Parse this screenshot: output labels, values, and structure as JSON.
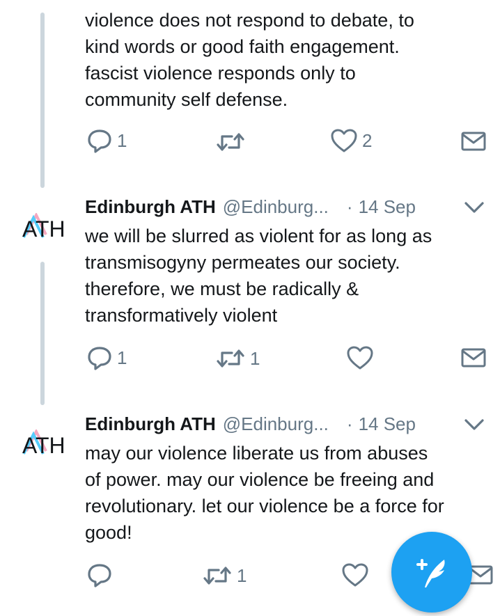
{
  "tweets": [
    {
      "text": "violence does not respond to debate, to\nkind words or good faith engagement.\nfascist violence responds only to\ncommunity self defense.",
      "reply_count": "1",
      "retweet_count": "",
      "like_count": "2"
    },
    {
      "avatar_text": "ATH",
      "name": "Edinburgh ATH",
      "handle": "@Edinburg...",
      "separator": "·",
      "time": "14 Sep",
      "text": "we will be slurred as violent for as long as\ntransmisogyny permeates our society.\ntherefore, we must be radically &\ntransformatively violent",
      "reply_count": "1",
      "retweet_count": "1",
      "like_count": ""
    },
    {
      "avatar_text": "ATH",
      "name": "Edinburgh ATH",
      "handle": "@Edinburg...",
      "separator": "·",
      "time": "14 Sep",
      "text": "may our violence liberate us from abuses\nof power. may our violence be freeing and\nrevolutionary. let our violence be a force for\ngood!",
      "reply_count": "",
      "retweet_count": "1",
      "like_count": ""
    }
  ],
  "icons": {
    "reply": "reply-icon",
    "retweet": "retweet-icon",
    "like": "heart-icon",
    "dm": "envelope-icon",
    "more": "chevron-down-icon",
    "compose": "compose-tweet-icon"
  },
  "colors": {
    "accent": "#1da1f2",
    "icon_gray": "#657786",
    "thread_line": "#ccd6dd",
    "avatar_pink": "#f4a8c0",
    "avatar_blue": "#55cdfc"
  }
}
